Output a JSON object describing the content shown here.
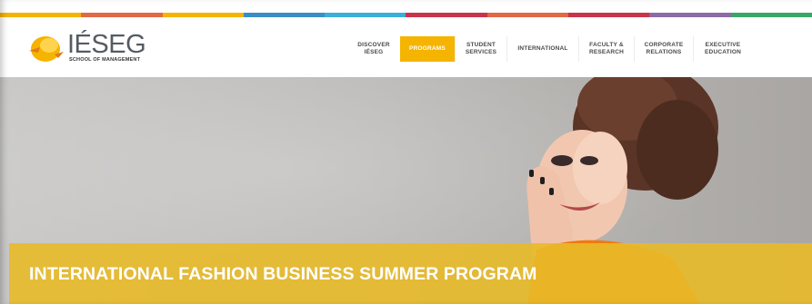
{
  "colors": {
    "stripe": [
      "#f5b400",
      "#e06a45",
      "#f5b400",
      "#3a8ec7",
      "#3ab0d9",
      "#c8344a",
      "#e06a45",
      "#c8344a",
      "#8d6aa6",
      "#3aa66a"
    ],
    "accent": "#f5b400",
    "banner": "#e8ba28"
  },
  "header": {
    "logo": {
      "text": "IÉSEG",
      "subtext": "SCHOOL OF MANAGEMENT"
    },
    "nav": [
      {
        "label": "DISCOVER\nIÉSEG",
        "active": false
      },
      {
        "label": "PROGRAMS",
        "active": true
      },
      {
        "label": "STUDENT\nSERVICES",
        "active": false
      },
      {
        "label": "INTERNATIONAL",
        "active": false
      },
      {
        "label": "FACULTY &\nRESEARCH",
        "active": false
      },
      {
        "label": "CORPORATE\nRELATIONS",
        "active": false
      },
      {
        "label": "EXECUTIVE\nEDUCATION",
        "active": false
      }
    ]
  },
  "hero": {
    "title": "INTERNATIONAL FASHION BUSINESS SUMMER PROGRAM"
  }
}
